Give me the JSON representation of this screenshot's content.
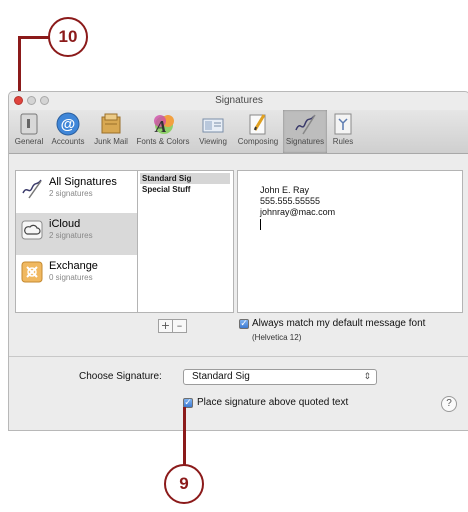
{
  "callouts": {
    "top": "10",
    "bottom": "9"
  },
  "window": {
    "title": "Signatures",
    "colors": {
      "close": "#e0443e",
      "minimize": "#d0d0d0",
      "zoom": "#d0d0d0"
    }
  },
  "toolbar": {
    "items": [
      {
        "label": "General",
        "icon": "general-icon"
      },
      {
        "label": "Accounts",
        "icon": "accounts-icon"
      },
      {
        "label": "Junk Mail",
        "icon": "junk-mail-icon"
      },
      {
        "label": "Fonts & Colors",
        "icon": "fonts-colors-icon"
      },
      {
        "label": "Viewing",
        "icon": "viewing-icon"
      },
      {
        "label": "Composing",
        "icon": "composing-icon"
      },
      {
        "label": "Signatures",
        "icon": "signatures-icon"
      },
      {
        "label": "Rules",
        "icon": "rules-icon"
      }
    ]
  },
  "accounts": [
    {
      "name": "All Signatures",
      "count": "2 signatures",
      "icon": "all-signatures-icon"
    },
    {
      "name": "iCloud",
      "count": "2 signatures",
      "icon": "icloud-icon"
    },
    {
      "name": "Exchange",
      "count": "0 signatures",
      "icon": "exchange-icon"
    }
  ],
  "signatures": [
    "Standard Sig",
    "Special Stuff"
  ],
  "signature_content": {
    "lines": [
      "John E. Ray",
      "555.555.55555",
      "johnray@mac.com"
    ]
  },
  "buttons": {
    "add": "+",
    "remove": "–",
    "help": "?"
  },
  "options": {
    "match_font_label": "Always match my default message font",
    "match_font_checked": true,
    "font_name": "(Helvetica 12)",
    "choose_label": "Choose Signature:",
    "choose_value": "Standard Sig",
    "place_above_label": "Place signature above quoted text",
    "place_above_checked": true
  }
}
